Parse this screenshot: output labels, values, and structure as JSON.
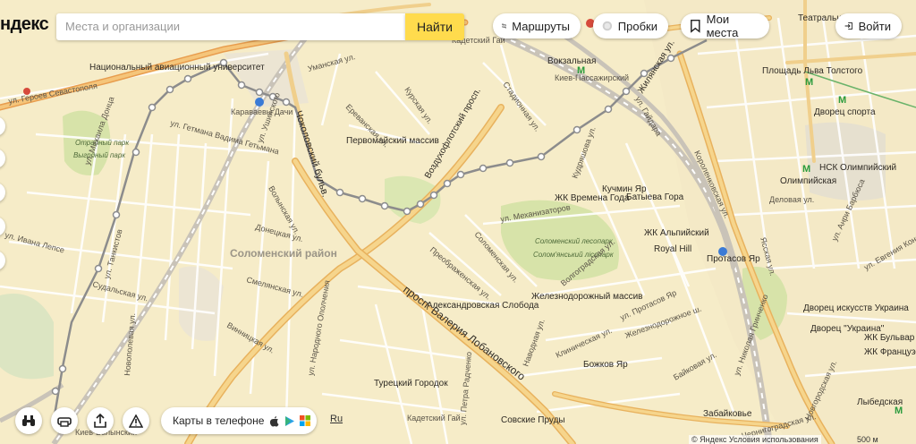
{
  "header": {
    "logo_text": "ндекс",
    "search_placeholder": "Места и организации",
    "search_button": "Найти",
    "routes_label": "Маршруты",
    "traffic_label": "Пробки",
    "my_places_label": "Мои места",
    "login_label": "Войти"
  },
  "bottom": {
    "phone_label": "Карты в телефоне",
    "lang_label": "Ru",
    "copyright": "© Яндекс  Условия использования",
    "scale_label": "500 м"
  },
  "map": {
    "district": "Соломенский район",
    "areas": [
      "Первомайский массив",
      "Железнодорожный массив",
      "Александровская Слобода",
      "Турецкий Городок",
      "Совские Пруды",
      "Забайковье",
      "Божков Яр",
      "Кучмин Яр",
      "Батыева Гора",
      "Royal Hill",
      "ЖК Времена Года",
      "ЖК Альпийский",
      "Протасов Яр",
      "Площадь Льва Толстого",
      "Дворец спорта",
      "НСК Олимпийский",
      "Дворец искусств Украина",
      "Дворец \"Украина\"",
      "ЖК Бульвар Фонтанов",
      "ЖК Французский",
      "Национальный авиационный университет",
      "Вокзальная",
      "Киев-Пассажирский",
      "Караваевы Дачи",
      "Кадетский Гай",
      "Киев-Волынский",
      "Олимпийская",
      "Лыбедская",
      "Театральная"
    ],
    "parks": [
      "Отрадный парк",
      "Выгрдный парк",
      "Соломенский лесопарк",
      "Солом'янський лісопарк"
    ],
    "streets": [
      "Уманская ул.",
      "Ереванская ул.",
      "Курская ул.",
      "Стадионная ул.",
      "Воздухофлотский просп.",
      "Соломенская ул.",
      "просп. Валерия Лобановского",
      "ул. Механизаторов",
      "ул. Протасов Яр",
      "Волгоградская ул.",
      "Преображенская ул.",
      "Донецкая ул.",
      "Смелянская ул.",
      "Винницкая ул.",
      "ул. Ушинского",
      "Волынская ул.",
      "ул. Народного Ополчения",
      "Чоколовский бульв.",
      "ул. Гайдара",
      "Жилянская ул.",
      "Короленковская ул.",
      "ул. Николая Гринченко",
      "Деловая ул.",
      "Кудряшова ул.",
      "Ясская ул.",
      "ул. Анри Барбюса",
      "ул. Евгения Коновальца",
      "Байковая ул.",
      "ул. Михаила Донца",
      "ул. Гетмана Вадима Гетьмана",
      "Новополевая ул.",
      "Судальская ул.",
      "ул. Танкистов",
      "ул. Ивана Лепсе",
      "ул. Героев Севастополя",
      "Клиническая ул.",
      "Наводная ул.",
      "ул. Петра Радченко",
      "Кадетский Гай",
      "Новгородская ул.",
      "Чернигоградская ул.",
      "Железнодорожное ш."
    ]
  },
  "colors": {
    "background": "#f6ecc8",
    "major_road": "#f2b45a",
    "railway": "#c9c3b8",
    "park": "#d7e3a9",
    "metro_line": "#7b7b7b",
    "search_button": "#ffdb4d",
    "metro_green": "#2a9b3c"
  },
  "icons": [
    "routes-icon",
    "traffic-icon",
    "bookmark-icon",
    "login-icon",
    "binoculars-icon",
    "printer-icon",
    "share-icon",
    "warning-icon",
    "apple-icon",
    "play-icon",
    "windows-icon",
    "metro-icon"
  ]
}
